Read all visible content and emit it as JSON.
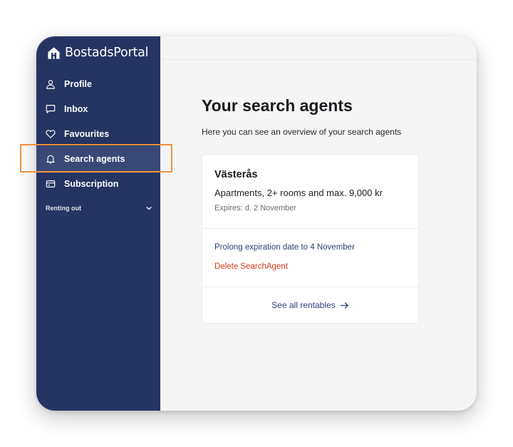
{
  "brand": {
    "name": "BostadsPortal",
    "logo_icon": "house-logo-icon"
  },
  "sidebar": {
    "items": [
      {
        "label": "Profile",
        "icon": "user-icon"
      },
      {
        "label": "Inbox",
        "icon": "chat-icon"
      },
      {
        "label": "Favourites",
        "icon": "heart-icon"
      },
      {
        "label": "Search agents",
        "icon": "bell-icon",
        "active": true
      },
      {
        "label": "Subscription",
        "icon": "credit-card-icon"
      }
    ],
    "renting_out": {
      "label": "Renting out",
      "icon": "chevron-down-icon"
    }
  },
  "main": {
    "title": "Your search agents",
    "subtitle": "Here you can see an overview of your search agents",
    "agent": {
      "location": "Västerås",
      "criteria": "Apartments, 2+ rooms and max. 9,000 kr",
      "expires": "Expires: d. 2 November",
      "prolong_label": "Prolong expiration date to 4 November",
      "delete_label": "Delete SearchAgent",
      "see_all_label": "See all rentables",
      "see_all_icon": "arrow-right-icon"
    }
  },
  "colors": {
    "sidebar_bg": "#263463",
    "active_bg": "#3a4878",
    "highlight": "#f0913a",
    "link": "#2e3f78",
    "danger": "#d63a1c"
  }
}
